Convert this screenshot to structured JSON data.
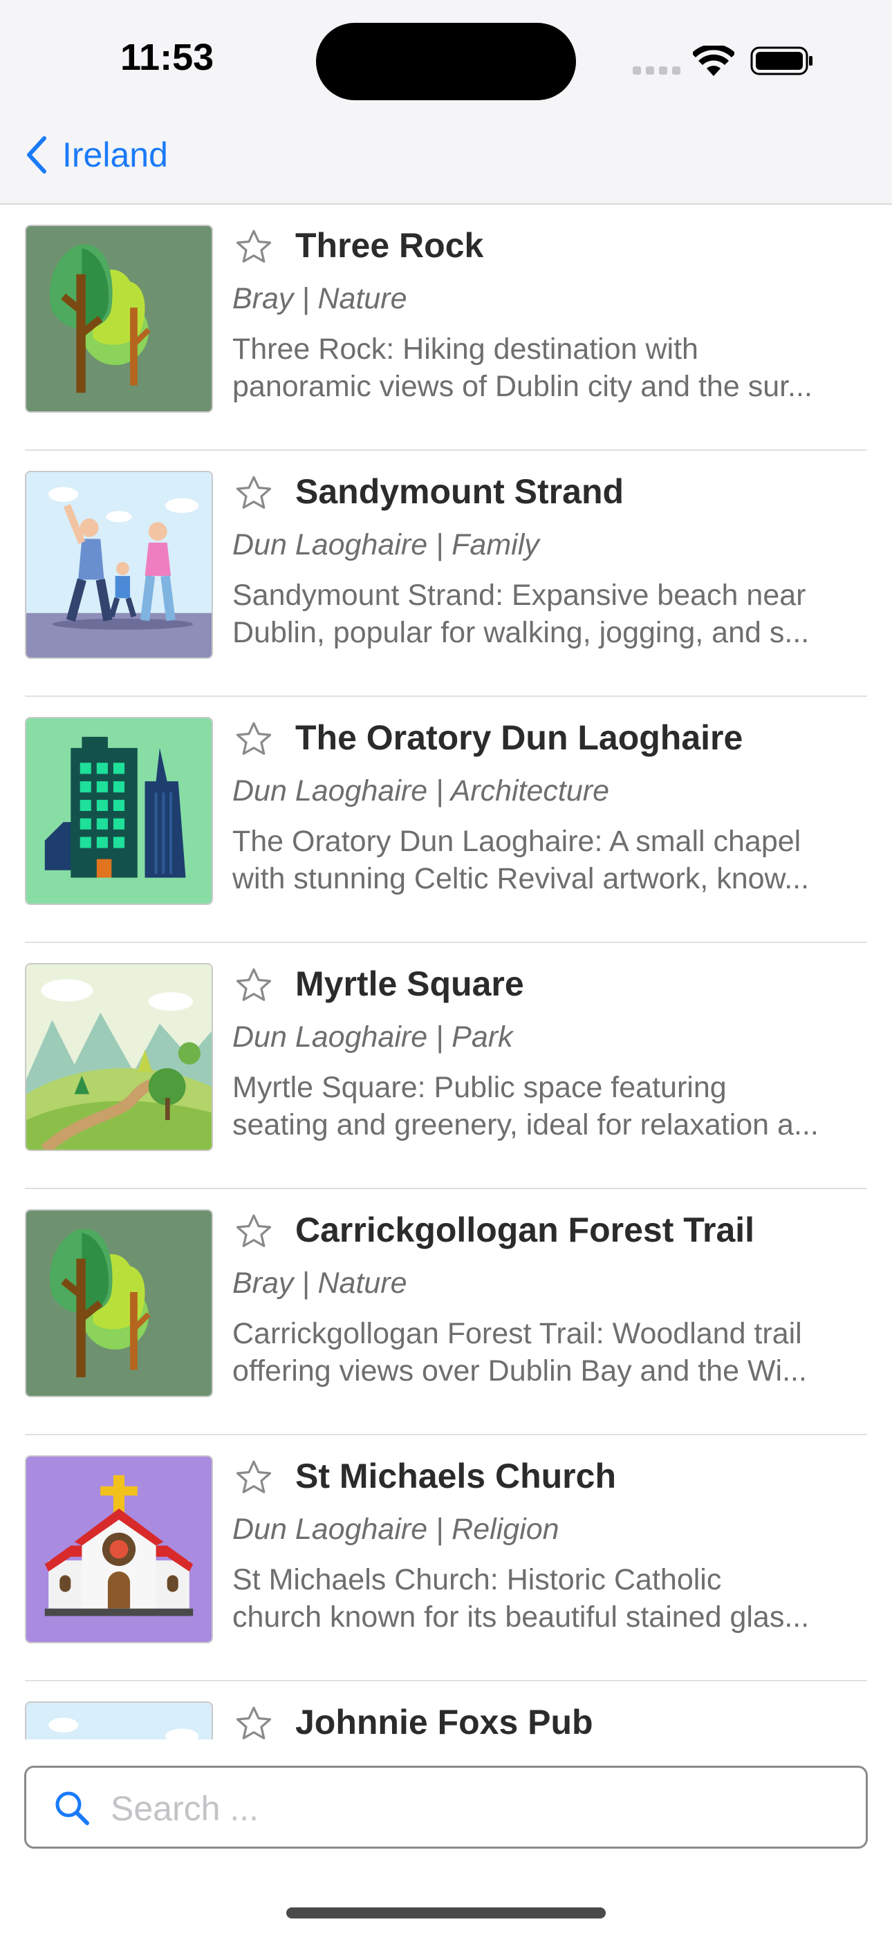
{
  "status": {
    "time": "11:53"
  },
  "nav": {
    "back_label": "Ireland"
  },
  "accent_color": "#1a7af8",
  "items": [
    {
      "title": "Three Rock",
      "meta": "Bray | Nature",
      "desc_line1": "Three Rock: Hiking destination with",
      "desc_line2": "panoramic views of Dublin city and the sur...",
      "thumb_icon": "trees-icon",
      "favorite": false
    },
    {
      "title": "Sandymount Strand",
      "meta": "Dun Laoghaire | Family",
      "desc_line1": "Sandymount Strand: Expansive beach near",
      "desc_line2": "Dublin, popular for walking, jogging, and s...",
      "thumb_icon": "family-walk-icon",
      "favorite": false
    },
    {
      "title": "The Oratory Dun Laoghaire",
      "meta": "Dun Laoghaire | Architecture",
      "desc_line1": "The Oratory Dun Laoghaire: A small chapel",
      "desc_line2": "with stunning Celtic Revival artwork, know...",
      "thumb_icon": "buildings-icon",
      "favorite": false
    },
    {
      "title": "Myrtle Square",
      "meta": "Dun Laoghaire | Park",
      "desc_line1": "Myrtle Square: Public space featuring",
      "desc_line2": "seating and greenery, ideal for relaxation a...",
      "thumb_icon": "park-landscape-icon",
      "favorite": false
    },
    {
      "title": "Carrickgollogan Forest Trail",
      "meta": "Bray | Nature",
      "desc_line1": "Carrickgollogan Forest Trail: Woodland trail",
      "desc_line2": "offering views over Dublin Bay and the Wi...",
      "thumb_icon": "trees-icon",
      "favorite": false
    },
    {
      "title": "St Michaels Church",
      "meta": "Dun Laoghaire | Religion",
      "desc_line1": "St Michaels Church: Historic Catholic",
      "desc_line2": "church known for its beautiful stained glas...",
      "thumb_icon": "church-icon",
      "favorite": false
    },
    {
      "title": "Johnnie Foxs Pub",
      "meta": "",
      "desc_line1": "",
      "desc_line2": "",
      "thumb_icon": "family-walk-icon",
      "favorite": false
    }
  ],
  "search": {
    "placeholder": "Search ..."
  }
}
